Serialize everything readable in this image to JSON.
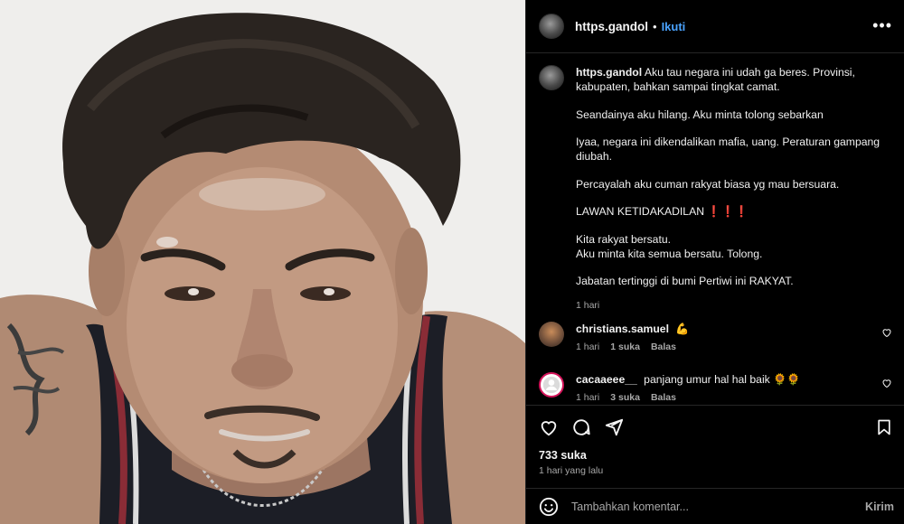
{
  "post": {
    "image_alt": "Selfie of a man with messy hair wearing a dark basketball jersey",
    "author": "https.gandol",
    "separator": "•",
    "follow_label": "Ikuti",
    "more_icon": "more-horizontal-icon",
    "caption_paragraphs": [
      "Aku tau negara ini udah ga beres. Provinsi, kabupaten, bahkan sampai tingkat camat.",
      "Seandainya aku hilang. Aku minta tolong sebarkan",
      "Iyaa, negara ini dikendalikan mafia, uang. Peraturan gampang diubah.",
      "Percayalah aku cuman rakyat biasa yg mau bersuara.",
      "LAWAN KETIDAKADILAN ❗❗❗",
      "Kita rakyat bersatu.\nAku minta kita semua bersatu. Tolong.",
      "Jabatan tertinggi di bumi Pertiwi ini RAKYAT."
    ],
    "caption_time": "1 hari",
    "likes": "733 suka",
    "posted_ago": "1 hari yang lalu"
  },
  "comments": [
    {
      "username": "christians.samuel",
      "text": "💪",
      "time": "1 hari",
      "likes": "1 suka",
      "reply": "Balas"
    },
    {
      "username": "cacaaeee__",
      "text": "panjang umur hal hal baik 🌻🌻",
      "time": "1 hari",
      "likes": "3 suka",
      "reply": "Balas"
    }
  ],
  "composer": {
    "placeholder": "Tambahkan komentar...",
    "post_label": "Kirim"
  },
  "colors": {
    "accent": "#4aa3ff",
    "background": "#000000",
    "muted": "#a8a8a8"
  }
}
